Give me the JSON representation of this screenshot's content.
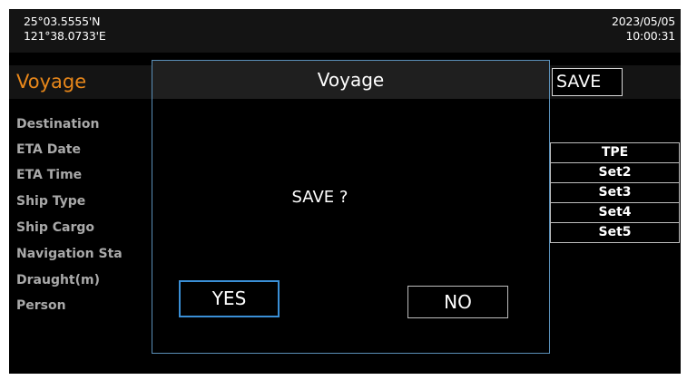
{
  "status": {
    "latitude": "25°03.5555'N",
    "longitude": "121°38.0733'E",
    "date": "2023/05/05",
    "time": "10:00:31"
  },
  "page": {
    "title": "Voyage",
    "save_label": "SAVE"
  },
  "fields": [
    {
      "label": "Destination"
    },
    {
      "label": "ETA Date"
    },
    {
      "label": "ETA Time"
    },
    {
      "label": "Ship Type"
    },
    {
      "label": "Ship Cargo"
    },
    {
      "label": "Navigation Sta"
    },
    {
      "label": "Draught(m)"
    },
    {
      "label": "Person"
    }
  ],
  "values": [
    "TPE",
    "Set2",
    "Set3",
    "Set4",
    "Set5"
  ],
  "dialog": {
    "title": "Voyage",
    "message": "SAVE ?",
    "yes_label": "YES",
    "no_label": "NO"
  },
  "colors": {
    "accent_title": "#e8871a",
    "focus_border": "#3a8fd6",
    "dialog_border": "#5a8fb8"
  }
}
